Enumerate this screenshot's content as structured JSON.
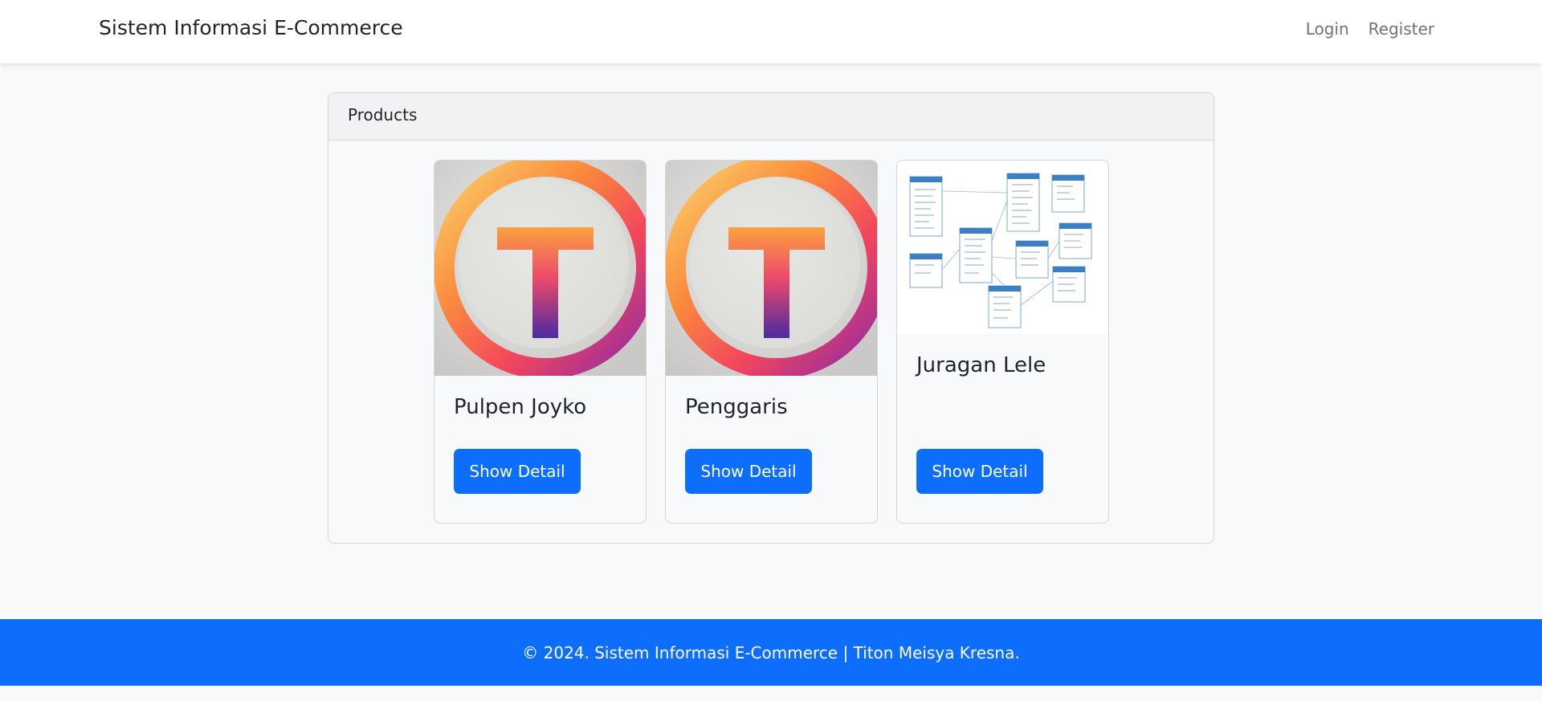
{
  "navbar": {
    "brand": "Sistem Informasi E-Commerce",
    "links": [
      "Login",
      "Register"
    ]
  },
  "products_card": {
    "header": "Products",
    "items": [
      {
        "title": "Pulpen Joyko",
        "button": "Show Detail",
        "image": "t-logo-image"
      },
      {
        "title": "Penggaris",
        "button": "Show Detail",
        "image": "t-logo-image"
      },
      {
        "title": "Juragan Lele",
        "button": "Show Detail",
        "image": "erd-diagram-image"
      }
    ]
  },
  "footer": {
    "text": "© 2024. Sistem Informasi E-Commerce | Titon Meisya Kresna."
  },
  "colors": {
    "primary": "#0d6efd",
    "background": "#f8f9fa",
    "navbar": "#ffffff"
  }
}
